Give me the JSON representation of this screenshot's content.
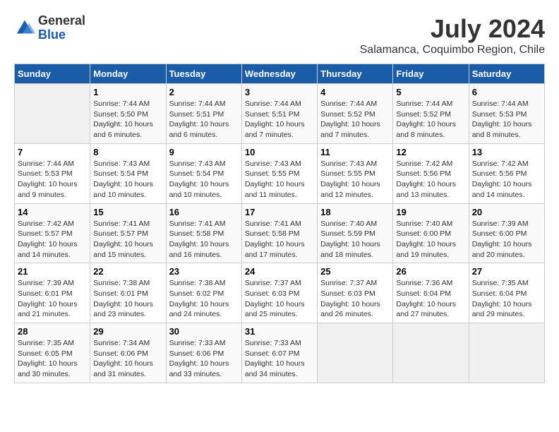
{
  "logo": {
    "general": "General",
    "blue": "Blue"
  },
  "title": {
    "month_year": "July 2024",
    "location": "Salamanca, Coquimbo Region, Chile"
  },
  "header": {
    "days": [
      "Sunday",
      "Monday",
      "Tuesday",
      "Wednesday",
      "Thursday",
      "Friday",
      "Saturday"
    ]
  },
  "weeks": [
    {
      "days": [
        {
          "num": "",
          "sunrise": "",
          "sunset": "",
          "daylight": "",
          "empty": true
        },
        {
          "num": "1",
          "sunrise": "Sunrise: 7:44 AM",
          "sunset": "Sunset: 5:50 PM",
          "daylight": "Daylight: 10 hours and 6 minutes."
        },
        {
          "num": "2",
          "sunrise": "Sunrise: 7:44 AM",
          "sunset": "Sunset: 5:51 PM",
          "daylight": "Daylight: 10 hours and 6 minutes."
        },
        {
          "num": "3",
          "sunrise": "Sunrise: 7:44 AM",
          "sunset": "Sunset: 5:51 PM",
          "daylight": "Daylight: 10 hours and 7 minutes."
        },
        {
          "num": "4",
          "sunrise": "Sunrise: 7:44 AM",
          "sunset": "Sunset: 5:52 PM",
          "daylight": "Daylight: 10 hours and 7 minutes."
        },
        {
          "num": "5",
          "sunrise": "Sunrise: 7:44 AM",
          "sunset": "Sunset: 5:52 PM",
          "daylight": "Daylight: 10 hours and 8 minutes."
        },
        {
          "num": "6",
          "sunrise": "Sunrise: 7:44 AM",
          "sunset": "Sunset: 5:53 PM",
          "daylight": "Daylight: 10 hours and 8 minutes."
        }
      ]
    },
    {
      "days": [
        {
          "num": "7",
          "sunrise": "Sunrise: 7:44 AM",
          "sunset": "Sunset: 5:53 PM",
          "daylight": "Daylight: 10 hours and 9 minutes."
        },
        {
          "num": "8",
          "sunrise": "Sunrise: 7:43 AM",
          "sunset": "Sunset: 5:54 PM",
          "daylight": "Daylight: 10 hours and 10 minutes."
        },
        {
          "num": "9",
          "sunrise": "Sunrise: 7:43 AM",
          "sunset": "Sunset: 5:54 PM",
          "daylight": "Daylight: 10 hours and 10 minutes."
        },
        {
          "num": "10",
          "sunrise": "Sunrise: 7:43 AM",
          "sunset": "Sunset: 5:55 PM",
          "daylight": "Daylight: 10 hours and 11 minutes."
        },
        {
          "num": "11",
          "sunrise": "Sunrise: 7:43 AM",
          "sunset": "Sunset: 5:55 PM",
          "daylight": "Daylight: 10 hours and 12 minutes."
        },
        {
          "num": "12",
          "sunrise": "Sunrise: 7:42 AM",
          "sunset": "Sunset: 5:56 PM",
          "daylight": "Daylight: 10 hours and 13 minutes."
        },
        {
          "num": "13",
          "sunrise": "Sunrise: 7:42 AM",
          "sunset": "Sunset: 5:56 PM",
          "daylight": "Daylight: 10 hours and 14 minutes."
        }
      ]
    },
    {
      "days": [
        {
          "num": "14",
          "sunrise": "Sunrise: 7:42 AM",
          "sunset": "Sunset: 5:57 PM",
          "daylight": "Daylight: 10 hours and 14 minutes."
        },
        {
          "num": "15",
          "sunrise": "Sunrise: 7:41 AM",
          "sunset": "Sunset: 5:57 PM",
          "daylight": "Daylight: 10 hours and 15 minutes."
        },
        {
          "num": "16",
          "sunrise": "Sunrise: 7:41 AM",
          "sunset": "Sunset: 5:58 PM",
          "daylight": "Daylight: 10 hours and 16 minutes."
        },
        {
          "num": "17",
          "sunrise": "Sunrise: 7:41 AM",
          "sunset": "Sunset: 5:58 PM",
          "daylight": "Daylight: 10 hours and 17 minutes."
        },
        {
          "num": "18",
          "sunrise": "Sunrise: 7:40 AM",
          "sunset": "Sunset: 5:59 PM",
          "daylight": "Daylight: 10 hours and 18 minutes."
        },
        {
          "num": "19",
          "sunrise": "Sunrise: 7:40 AM",
          "sunset": "Sunset: 6:00 PM",
          "daylight": "Daylight: 10 hours and 19 minutes."
        },
        {
          "num": "20",
          "sunrise": "Sunrise: 7:39 AM",
          "sunset": "Sunset: 6:00 PM",
          "daylight": "Daylight: 10 hours and 20 minutes."
        }
      ]
    },
    {
      "days": [
        {
          "num": "21",
          "sunrise": "Sunrise: 7:39 AM",
          "sunset": "Sunset: 6:01 PM",
          "daylight": "Daylight: 10 hours and 21 minutes."
        },
        {
          "num": "22",
          "sunrise": "Sunrise: 7:38 AM",
          "sunset": "Sunset: 6:01 PM",
          "daylight": "Daylight: 10 hours and 23 minutes."
        },
        {
          "num": "23",
          "sunrise": "Sunrise: 7:38 AM",
          "sunset": "Sunset: 6:02 PM",
          "daylight": "Daylight: 10 hours and 24 minutes."
        },
        {
          "num": "24",
          "sunrise": "Sunrise: 7:37 AM",
          "sunset": "Sunset: 6:03 PM",
          "daylight": "Daylight: 10 hours and 25 minutes."
        },
        {
          "num": "25",
          "sunrise": "Sunrise: 7:37 AM",
          "sunset": "Sunset: 6:03 PM",
          "daylight": "Daylight: 10 hours and 26 minutes."
        },
        {
          "num": "26",
          "sunrise": "Sunrise: 7:36 AM",
          "sunset": "Sunset: 6:04 PM",
          "daylight": "Daylight: 10 hours and 27 minutes."
        },
        {
          "num": "27",
          "sunrise": "Sunrise: 7:35 AM",
          "sunset": "Sunset: 6:04 PM",
          "daylight": "Daylight: 10 hours and 29 minutes."
        }
      ]
    },
    {
      "days": [
        {
          "num": "28",
          "sunrise": "Sunrise: 7:35 AM",
          "sunset": "Sunset: 6:05 PM",
          "daylight": "Daylight: 10 hours and 30 minutes."
        },
        {
          "num": "29",
          "sunrise": "Sunrise: 7:34 AM",
          "sunset": "Sunset: 6:06 PM",
          "daylight": "Daylight: 10 hours and 31 minutes."
        },
        {
          "num": "30",
          "sunrise": "Sunrise: 7:33 AM",
          "sunset": "Sunset: 6:06 PM",
          "daylight": "Daylight: 10 hours and 33 minutes."
        },
        {
          "num": "31",
          "sunrise": "Sunrise: 7:33 AM",
          "sunset": "Sunset: 6:07 PM",
          "daylight": "Daylight: 10 hours and 34 minutes."
        },
        {
          "num": "",
          "sunrise": "",
          "sunset": "",
          "daylight": "",
          "empty": true
        },
        {
          "num": "",
          "sunrise": "",
          "sunset": "",
          "daylight": "",
          "empty": true
        },
        {
          "num": "",
          "sunrise": "",
          "sunset": "",
          "daylight": "",
          "empty": true
        }
      ]
    }
  ]
}
